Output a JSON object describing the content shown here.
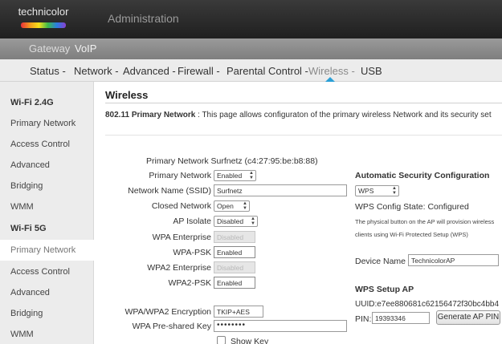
{
  "header": {
    "brand": "technicolor",
    "title": "Administration",
    "subtabs": [
      "Gateway",
      "VoIP"
    ]
  },
  "nav": {
    "items": [
      "Status -",
      "Network -",
      "Advanced -",
      "Firewall -",
      "Parental Control -",
      "Wireless -",
      "USB"
    ],
    "active": "Wireless -"
  },
  "sidebar": {
    "items": [
      {
        "label": "Wi-Fi 2.4G",
        "type": "heading"
      },
      {
        "label": "Primary Network",
        "type": "link"
      },
      {
        "label": "Access Control",
        "type": "link"
      },
      {
        "label": "Advanced",
        "type": "link"
      },
      {
        "label": "Bridging",
        "type": "link"
      },
      {
        "label": "WMM",
        "type": "link"
      },
      {
        "label": "Wi-Fi 5G",
        "type": "heading"
      },
      {
        "label": "Primary Network",
        "type": "link",
        "active": true
      },
      {
        "label": "Access Control",
        "type": "link"
      },
      {
        "label": "Advanced",
        "type": "link"
      },
      {
        "label": "Bridging",
        "type": "link"
      },
      {
        "label": "WMM",
        "type": "link"
      }
    ]
  },
  "main": {
    "title": "Wireless",
    "description_bold": "802.11 Primary Network",
    "description_text": " :  This page allows configuraton of the primary wireless Network and its security set",
    "network_heading": "Primary Network Surfnetz (c4:27:95:be:b8:88)",
    "form": {
      "primary_network": {
        "label": "Primary Network",
        "value": "Enabled"
      },
      "ssid": {
        "label": "Network Name (SSID)",
        "value": "Surfnetz"
      },
      "closed_network": {
        "label": "Closed Network",
        "value": "Open"
      },
      "ap_isolate": {
        "label": "AP Isolate",
        "value": "Disabled"
      },
      "wpa_enterprise": {
        "label": "WPA Enterprise",
        "value": "Disabled"
      },
      "wpa_psk": {
        "label": "WPA-PSK",
        "value": "Enabled"
      },
      "wpa2_enterprise": {
        "label": "WPA2 Enterprise",
        "value": "Disabled"
      },
      "wpa2_psk": {
        "label": "WPA2-PSK",
        "value": "Enabled"
      },
      "encryption": {
        "label": "WPA/WPA2 Encryption",
        "value": "TKIP+AES"
      },
      "psk": {
        "label": "WPA Pre-shared Key",
        "value": "••••••••"
      },
      "show_key": {
        "label": "Show Key",
        "checked": false
      }
    },
    "security": {
      "heading": "Automatic Security Configuration",
      "mode": "WPS",
      "state": "WPS Config State: Configured",
      "note": "The physical button on the AP will provision wireless clients using Wi-Fi Protected Setup (WPS)",
      "device_name_label": "Device Name",
      "device_name": "TechnicolorAP",
      "setup_heading": "WPS Setup AP",
      "uuid": "UUID:e7ee880681c62156472f30bc4bb4",
      "pin_label": "PIN:",
      "pin": "19393346",
      "generate_button": "Generate AP PIN"
    }
  },
  "colors": {
    "accent": "#2a9fd6",
    "topbar": "#2b2b2b",
    "sidebar": "#ececec"
  }
}
